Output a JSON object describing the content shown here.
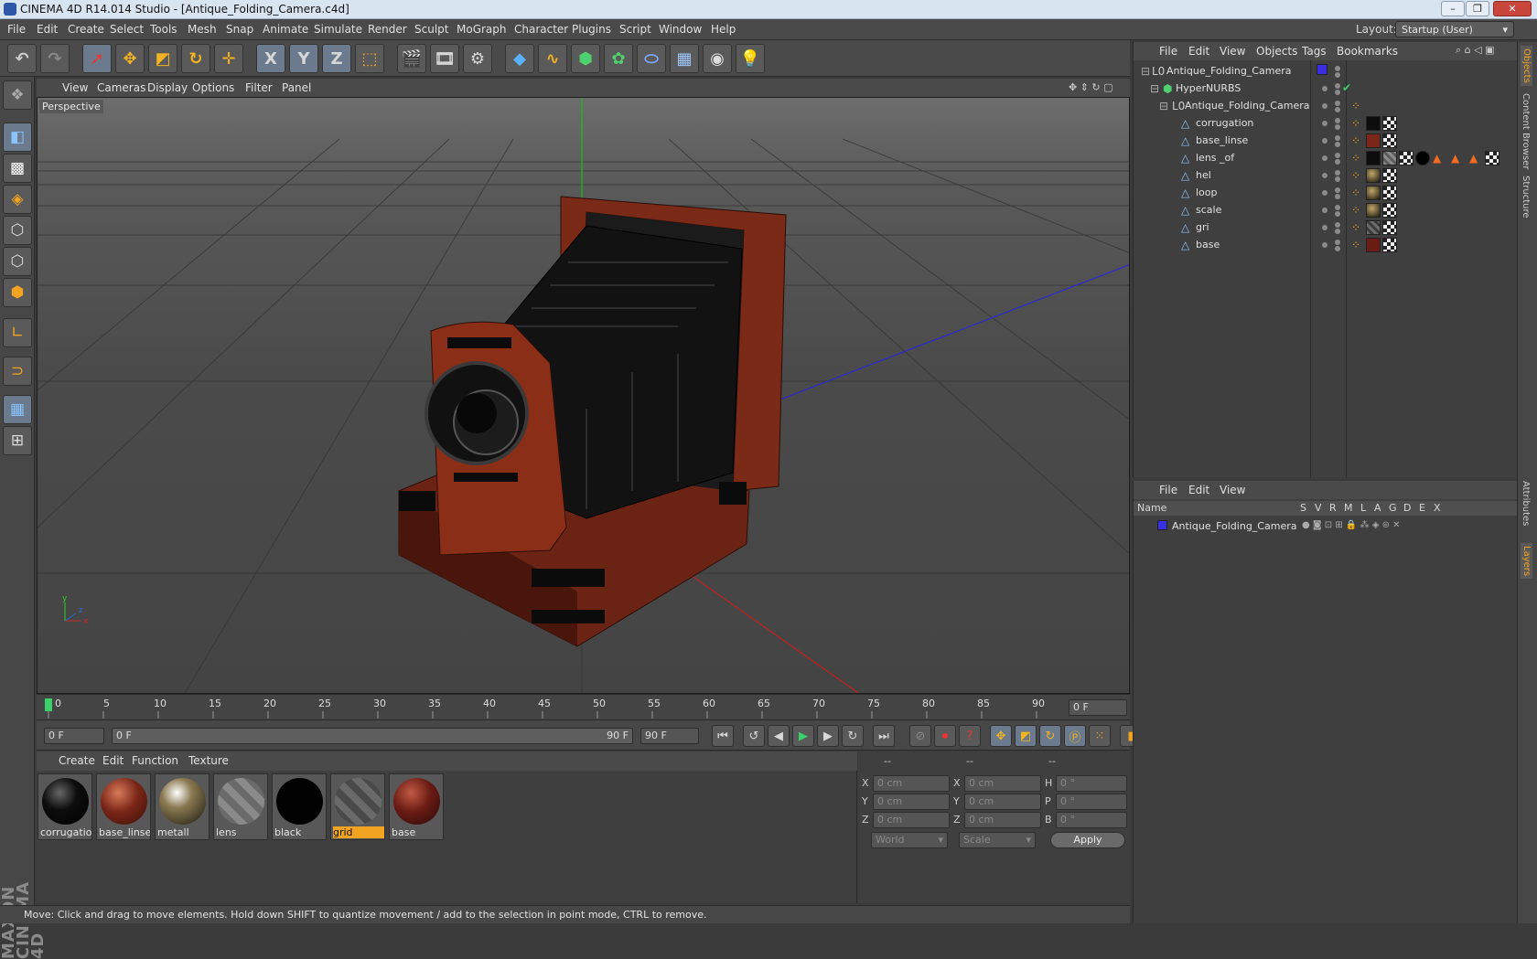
{
  "window": {
    "title": "CINEMA 4D R14.014 Studio - [Antique_Folding_Camera.c4d]"
  },
  "menubar": {
    "items": [
      "File",
      "Edit",
      "Create",
      "Select",
      "Tools",
      "Mesh",
      "Snap",
      "Animate",
      "Simulate",
      "Render",
      "Sculpt",
      "MoGraph",
      "Character",
      "Plugins",
      "Script",
      "Window",
      "Help"
    ],
    "layout_label": "Layout:",
    "layout_value": "Startup (User)"
  },
  "toolbar": {
    "axis_x": "X",
    "axis_y": "Y",
    "axis_z": "Z"
  },
  "viewport": {
    "menu": [
      "View",
      "Cameras",
      "Display",
      "Options",
      "Filter",
      "Panel"
    ],
    "label": "Perspective"
  },
  "timeline": {
    "ticks": [
      "0",
      "5",
      "10",
      "15",
      "20",
      "25",
      "30",
      "35",
      "40",
      "45",
      "50",
      "55",
      "60",
      "65",
      "70",
      "75",
      "80",
      "85",
      "90"
    ],
    "current_frame": "0 F"
  },
  "transport": {
    "start_field": "0 F",
    "range_left": "0 F",
    "range_right": "90 F",
    "end_field": "90 F"
  },
  "materials": {
    "menu": [
      "Create",
      "Edit",
      "Function",
      "Texture"
    ],
    "items": [
      {
        "label": "corrugatio",
        "color": "#0d0d0d",
        "selected": false
      },
      {
        "label": "base_linse",
        "color": "#7a2618",
        "selected": false
      },
      {
        "label": "metall",
        "color": "#8a7a52",
        "selected": false
      },
      {
        "label": "lens",
        "color": "#7a7a7a",
        "selected": false
      },
      {
        "label": "black",
        "color": "#020202",
        "selected": false
      },
      {
        "label": "grid",
        "color": "#5c5c5c",
        "selected": true
      },
      {
        "label": "base",
        "color": "#6a1c14",
        "selected": false
      }
    ]
  },
  "coords": {
    "headers": [
      "--",
      "--",
      "--"
    ],
    "rows": [
      {
        "a": "X",
        "av": "0 cm",
        "b": "X",
        "bv": "0 cm",
        "c": "H",
        "cv": "0 °"
      },
      {
        "a": "Y",
        "av": "0 cm",
        "b": "Y",
        "bv": "0 cm",
        "c": "P",
        "cv": "0 °"
      },
      {
        "a": "Z",
        "av": "0 cm",
        "b": "Z",
        "bv": "0 cm",
        "c": "B",
        "cv": "0 °"
      }
    ],
    "mode1": "World",
    "mode2": "Scale",
    "apply": "Apply"
  },
  "status": "Move: Click and drag to move elements. Hold down SHIFT to quantize movement / add to the selection in point mode, CTRL to remove.",
  "objects": {
    "menu": [
      "File",
      "Edit",
      "View",
      "Objects",
      "Tags",
      "Bookmarks"
    ],
    "rows": [
      {
        "name": "Antique_Folding_Camera",
        "indent": 0,
        "type": "null"
      },
      {
        "name": "HyperNURBS",
        "indent": 1,
        "type": "nurbs"
      },
      {
        "name": "Antique_Folding_Camera",
        "indent": 2,
        "type": "null"
      },
      {
        "name": "corrugation",
        "indent": 3,
        "type": "poly"
      },
      {
        "name": "base_linse",
        "indent": 3,
        "type": "poly"
      },
      {
        "name": "lens _of",
        "indent": 3,
        "type": "poly"
      },
      {
        "name": "hel",
        "indent": 3,
        "type": "poly"
      },
      {
        "name": "loop",
        "indent": 3,
        "type": "poly"
      },
      {
        "name": "scale",
        "indent": 3,
        "type": "poly"
      },
      {
        "name": "gri",
        "indent": 3,
        "type": "poly"
      },
      {
        "name": "base",
        "indent": 3,
        "type": "poly"
      }
    ]
  },
  "layers": {
    "menu": [
      "File",
      "Edit",
      "View"
    ],
    "columns": [
      "Name",
      "S",
      "V",
      "R",
      "M",
      "L",
      "A",
      "G",
      "D",
      "E",
      "X"
    ],
    "rows": [
      {
        "name": "Antique_Folding_Camera",
        "color": "#3a2ee0"
      }
    ]
  },
  "right_tabs": [
    "Objects",
    "Content Browser",
    "Structure",
    "Attributes",
    "Layers"
  ],
  "logo": "MAXON CINEMA 4D"
}
